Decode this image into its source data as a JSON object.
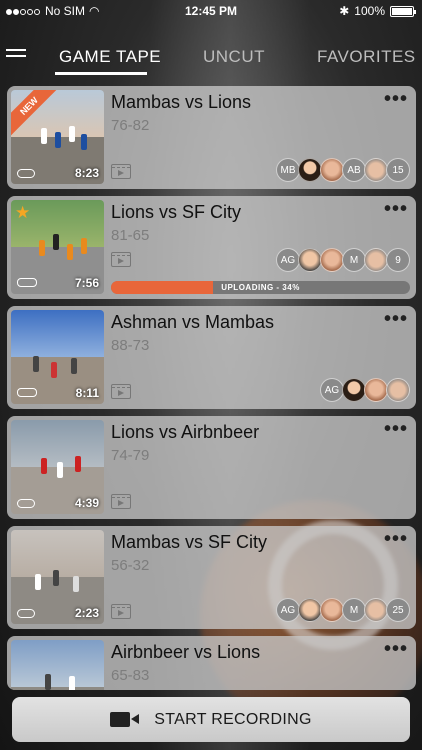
{
  "status": {
    "carrier": "No SIM",
    "time": "12:45 PM",
    "battery": "100%"
  },
  "tabs": [
    {
      "label": "GAME TAPE",
      "active": true
    },
    {
      "label": "UNCUT",
      "active": false
    },
    {
      "label": "FAVORITES",
      "active": false
    }
  ],
  "games": [
    {
      "title": "Mambas vs Lions",
      "score": "76-82",
      "duration": "8:23",
      "badge": "NEW",
      "storage": "cloud",
      "avatars": [
        "MB",
        "face",
        "face",
        "AB",
        "face",
        "15"
      ]
    },
    {
      "title": "Lions vs SF City",
      "score": "81-65",
      "duration": "7:56",
      "starred": true,
      "storage": "device",
      "avatars": [
        "AG",
        "face",
        "face",
        "M",
        "face",
        "9"
      ],
      "upload": {
        "label": "UPLOADING - 34%",
        "percent": 34
      }
    },
    {
      "title": "Ashman vs Mambas",
      "score": "88-73",
      "duration": "8:11",
      "storage": "device",
      "avatars": [
        "AG",
        "face",
        "face",
        "face"
      ]
    },
    {
      "title": "Lions vs Airbnbeer",
      "score": "74-79",
      "duration": "4:39",
      "storage": "cloud",
      "avatars": []
    },
    {
      "title": "Mambas vs SF City",
      "score": "56-32",
      "duration": "2:23",
      "storage": "cloud",
      "avatars": [
        "AG",
        "face",
        "face",
        "M",
        "face",
        "25"
      ]
    },
    {
      "title": "Airbnbeer vs Lions",
      "score": "65-83"
    }
  ],
  "more_label": "•••",
  "record_button": {
    "label": "START RECORDING"
  },
  "colors": {
    "accent": "#e8663a",
    "star": "#f5a623"
  }
}
